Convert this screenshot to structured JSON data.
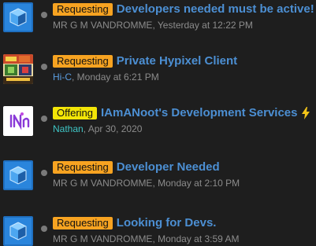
{
  "threads": [
    {
      "avatar_icon": "blue-cube-avatar-icon",
      "prefix": "Requesting",
      "title": "Developers needed must be active!",
      "author": "MR G M VANDROMME",
      "date": "Yesterday at 12:22 PM"
    },
    {
      "avatar_icon": "minecraft-artwork-avatar-icon",
      "prefix": "Requesting",
      "title": "Private Hypixel Client",
      "author": "Hi-C",
      "date": "Monday at 6:21 PM"
    },
    {
      "avatar_icon": "purple-logo-avatar-icon",
      "prefix": "Offering",
      "title": "IAmANoot's Development Services",
      "author": "Nathan",
      "date": "Apr 30, 2020"
    },
    {
      "avatar_icon": "blue-cube-avatar-icon",
      "prefix": "Requesting",
      "title": "Developer Needed",
      "author": "MR G M VANDROMME",
      "date": "Monday at 2:10 PM"
    },
    {
      "avatar_icon": "blue-cube-avatar-icon",
      "prefix": "Requesting",
      "title": "Looking for Devs.",
      "author": "MR G M VANDROMME",
      "date": "Monday at 3:59 AM"
    }
  ],
  "meta_separator": ", ",
  "colors": {
    "background": "#1e1e1e",
    "title_link": "#4c8fd3",
    "prefix_requesting": "#f7a321",
    "prefix_offering": "#f3e507",
    "meta_text": "#8c8c8c",
    "author_hi_c": "#5b9de0",
    "author_nathan": "#3fc5c5"
  }
}
